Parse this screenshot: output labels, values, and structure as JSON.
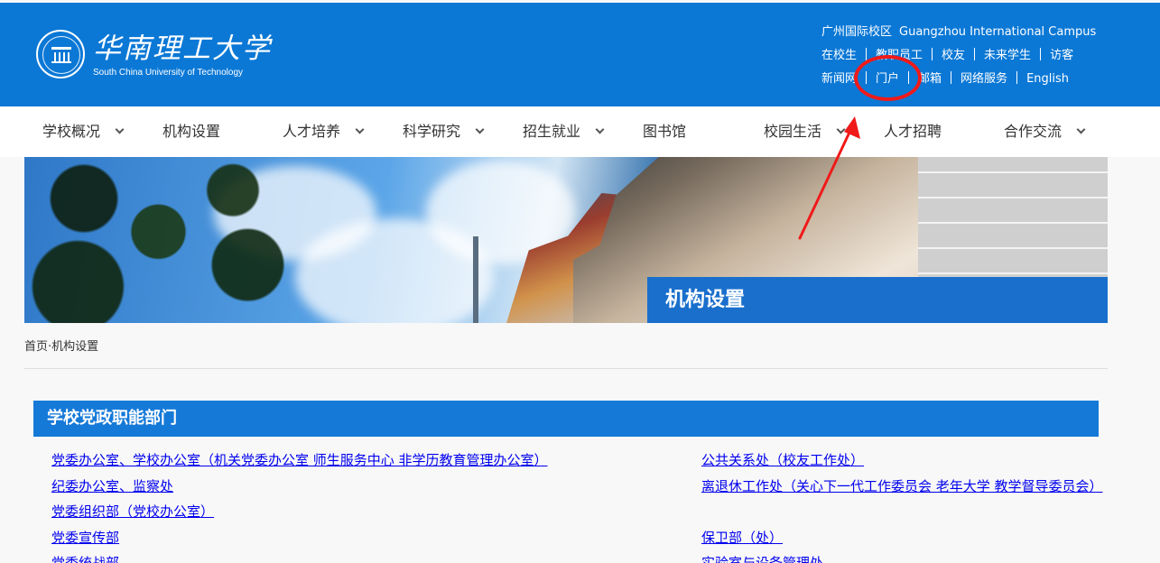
{
  "header": {
    "logo": {
      "cn": "华南理工大学",
      "en": "South China University of Technology"
    },
    "campus": {
      "cn": "广州国际校区",
      "en": "Guangzhou International Campus"
    },
    "links_row1": [
      "在校生",
      "教职员工",
      "校友",
      "未来学生",
      "访客"
    ],
    "links_row2": [
      "新闻网",
      "门户",
      "邮箱",
      "网络服务",
      "English"
    ]
  },
  "nav": {
    "items": [
      "学校概况",
      "机构设置",
      "人才培养",
      "科学研究",
      "招生就业",
      "图书馆",
      "校园生活",
      "人才招聘",
      "合作交流"
    ]
  },
  "banner": {
    "title": "机构设置"
  },
  "breadcrumb": "首页·机构设置",
  "section": {
    "title": "学校党政职能部门",
    "left_items": [
      "党委办公室、学校办公室（机关党委办公室 师生服务中心 非学历教育管理办公室）",
      "纪委办公室、监察处",
      "党委组织部（党校办公室）",
      "党委宣传部",
      "党委统战部"
    ],
    "right_items": [
      "公共关系处（校友工作处）",
      "离退休工作处（关心下一代工作委员会 老年大学 教学督导委员会）",
      "保卫部（处）",
      "实验室与设备管理处"
    ]
  },
  "colors": {
    "header_blue": "#0b78d6",
    "section_blue": "#1579d8",
    "annotation_red": "#f01a1a"
  },
  "icons": {
    "logo": "university-seal-icon",
    "nav_dropdown": "chevron-down-icon",
    "annotation_circle": "red-circle-annotation",
    "annotation_arrow": "red-arrow-annotation"
  }
}
